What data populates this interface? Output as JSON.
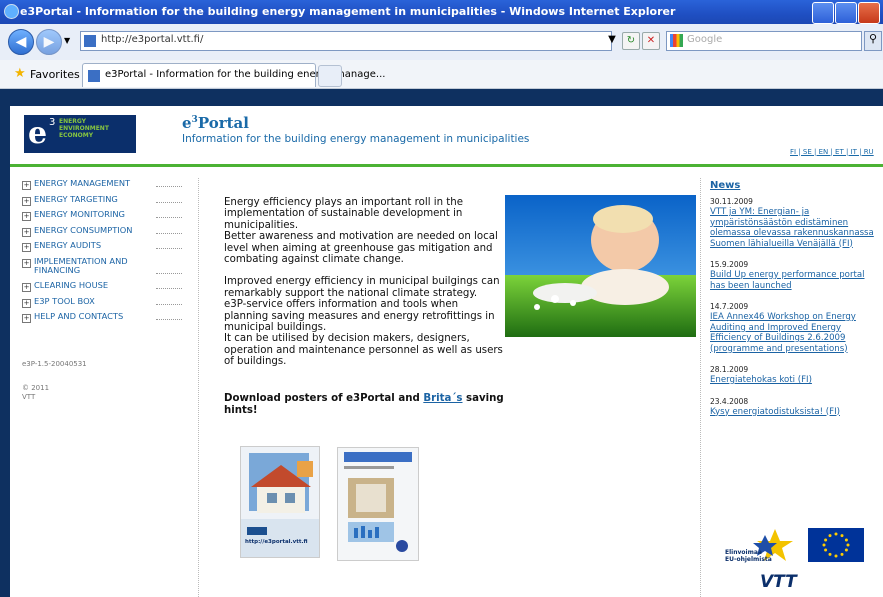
{
  "window": {
    "title": "e3Portal - Information for the building energy management in municipalities - Windows Internet Explorer"
  },
  "browser": {
    "url": "http://e3portal.vtt.fi/",
    "search_placeholder": "Google",
    "favorites_label": "Favorites",
    "tab_title": "e3Portal - Information for the building energy manage..."
  },
  "header": {
    "logo_letter": "e",
    "logo_superscript": "3",
    "logo_words": [
      "ENERGY",
      "ENVIRONMENT",
      "ECONOMY"
    ],
    "title_prefix": "e",
    "title_sup": "3",
    "title_suffix": "Portal",
    "subtitle": "Information for the building energy management in municipalities",
    "languages": "FI | SE | EN | ET | IT | RU"
  },
  "sidebar": {
    "items": [
      {
        "label": "ENERGY MANAGEMENT"
      },
      {
        "label": "ENERGY TARGETING"
      },
      {
        "label": "ENERGY MONITORING"
      },
      {
        "label": "ENERGY CONSUMPTION"
      },
      {
        "label": "ENERGY AUDITS"
      },
      {
        "label": "IMPLEMENTATION AND FINANCING"
      },
      {
        "label": "CLEARING HOUSE"
      },
      {
        "label": "E3P TOOL BOX"
      },
      {
        "label": "HELP AND CONTACTS"
      }
    ],
    "version": "e3P-1.5-20040531",
    "copyright_year": "© 2011",
    "copyright_org": "VTT"
  },
  "main": {
    "para1": "Energy efficiency plays an important roll in the implementation of sustainable development in municipalities.",
    "para1b": "Better awareness and motivation are needed on local level when aiming at greenhouse gas mitigation and combating against climate change.",
    "para2": "Improved energy efficiency in municipal builgings can remarkably support the national climate strategy.",
    "para2b": "e3P-service offers information and tools when planning saving measures and energy retrofittings in municipal buildings.",
    "para2c": "It can be utilised by decision makers, designers, operation and maintenance personnel as well as users of buildings.",
    "download_prefix": "Download posters of e3Portal and ",
    "download_link": "Brita´s",
    "download_suffix": " saving hints!",
    "poster1_url": "http://e3portal.vtt.fi"
  },
  "news": {
    "heading": "News",
    "items": [
      {
        "date": "30.11.2009",
        "text": "VTT ja YM: Energian- ja ympäristönsäästön edistäminen olemassa olevassa rakennuskannassa Suomen lähialueilla Venäjällä (FI)"
      },
      {
        "date": "15.9.2009",
        "text": "Build Up energy performance portal has been launched"
      },
      {
        "date": "14.7.2009",
        "text": "IEA Annex46 Workshop on Energy Auditing and Improved Energy Efficiency of Buildings 2.6.2009 (programme and presentations)"
      },
      {
        "date": "28.1.2009",
        "text": "Energiatehokas koti (FI)"
      },
      {
        "date": "23.4.2008",
        "text": "Kysy energiatodistuksista! (FI)"
      }
    ]
  },
  "footer_logos": {
    "eu_text1": "Elinvoimaa",
    "eu_text2": "EU-ohjelmista",
    "vtt": "VTT"
  }
}
